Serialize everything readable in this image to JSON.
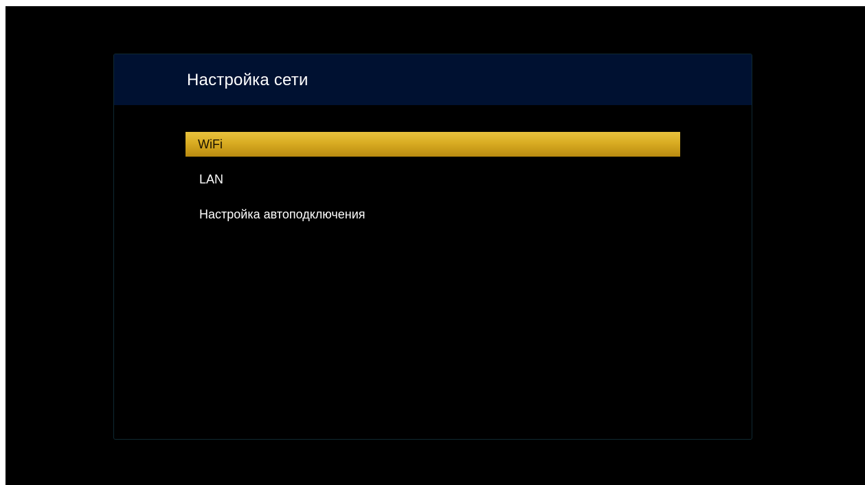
{
  "dialog": {
    "title": "Настройка сети"
  },
  "menu": {
    "selected_index": 0,
    "items": [
      {
        "label": "WiFi"
      },
      {
        "label": "LAN"
      },
      {
        "label": "Настройка автоподключения"
      }
    ]
  },
  "colors": {
    "screen_background": "#000000",
    "header_background": "#001131",
    "selection_highlight": "#d9ac22",
    "text": "#ffffff"
  }
}
